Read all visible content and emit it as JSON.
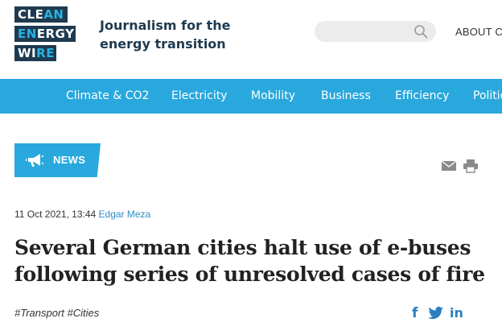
{
  "brand": {
    "logo_line1_a": "CLE",
    "logo_line1_b": "AN",
    "logo_line2_a": "EN",
    "logo_line2_b": "ERGY",
    "logo_line3_a": "WI",
    "logo_line3_b": "RE",
    "tagline_line1": "Journalism for the",
    "tagline_line2": "energy transition",
    "dark_color": "#1f3a4f",
    "accent_color": "#29b2e3"
  },
  "header": {
    "search_icon": "search-icon",
    "about_link": "ABOUT CL"
  },
  "nav": {
    "background": "#29a8dd",
    "items": [
      {
        "label": "Climate & CO2"
      },
      {
        "label": "Electricity"
      },
      {
        "label": "Mobility"
      },
      {
        "label": "Business"
      },
      {
        "label": "Efficiency"
      },
      {
        "label": "Politic"
      }
    ]
  },
  "article": {
    "category": "NEWS",
    "category_icon": "megaphone-icon",
    "email_icon": "envelope-icon",
    "print_icon": "printer-icon",
    "date": "11 Oct 2021, 13:44",
    "author": "Edgar Meza",
    "title_line1": "Several German cities halt use of e-buses",
    "title_line2": "following series of unresolved cases of fire",
    "tags": "#Transport #Cities",
    "share": {
      "facebook": "f",
      "twitter_icon": "twitter-icon",
      "linkedin": "in"
    }
  }
}
